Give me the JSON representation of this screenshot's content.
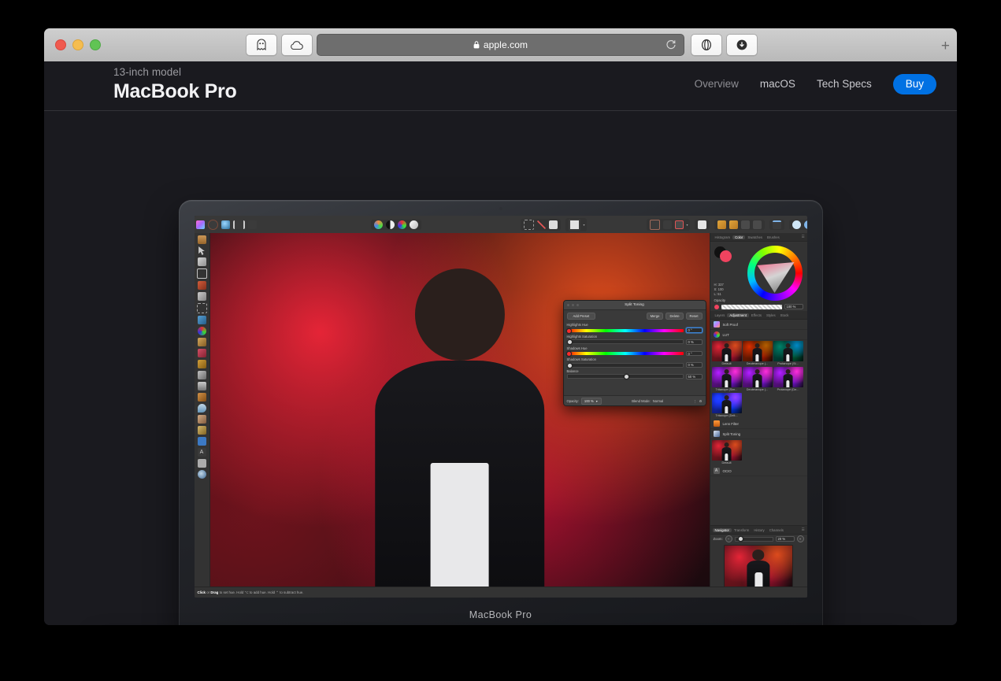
{
  "browser": {
    "url": "apple.com",
    "lock_icon": "lock-icon",
    "reload_icon": "reload-icon",
    "ghost_icon": "ghost-extension-icon",
    "cloud_icon": "cloud-extension-icon",
    "reader_icon": "reader-view-icon",
    "download_icon": "downloads-icon",
    "new_tab_label": "+",
    "traffic": [
      "close",
      "minimize",
      "zoom"
    ]
  },
  "page": {
    "kicker": "13-inch model",
    "title": "MacBook Pro",
    "nav": [
      {
        "label": "Overview",
        "active": false
      },
      {
        "label": "macOS",
        "active": true
      },
      {
        "label": "Tech Specs",
        "active": true
      }
    ],
    "cta": {
      "label": "Buy",
      "color": "#0071e3"
    }
  },
  "device": {
    "label": "MacBook Pro"
  },
  "app": {
    "status_bar": {
      "bold1": "Click",
      "mid1": " or ",
      "bold2": "Drag",
      "rest": " to set hue. Hold ⌥ to add hue. Hold ⌃ to subtract hue."
    },
    "dialog": {
      "title": "Split Toning",
      "add_preset": "Add Preset",
      "merge": "Merge",
      "delete": "Delete",
      "reset": "Reset",
      "sliders": [
        {
          "label": "Highlights Hue",
          "value": "0 °",
          "type": "hue",
          "pos": 0,
          "focused": true
        },
        {
          "label": "Highlights Saturation",
          "value": "0 %",
          "type": "plain",
          "pos": 0,
          "focused": false
        },
        {
          "label": "Shadows Hue",
          "value": "0 °",
          "type": "hue",
          "pos": 0,
          "focused": false
        },
        {
          "label": "Shadows Saturation",
          "value": "0 %",
          "type": "plain",
          "pos": 0,
          "focused": false
        },
        {
          "label": "Balance",
          "value": "50 %",
          "type": "plain",
          "pos": 50,
          "focused": false
        }
      ],
      "opacity_label": "Opacity:",
      "opacity_value": "100 %",
      "blend_label": "Blend Mode:",
      "blend_value": "Normal"
    },
    "color_panel": {
      "tabs": [
        "Histogram",
        "Color",
        "Swatches",
        "Brushes"
      ],
      "active_tab": "Color",
      "hsl": [
        "H: 337",
        "S: 100",
        "L: 51"
      ],
      "opacity_label": "Opacity",
      "opacity_value": "100 %"
    },
    "adjustment_panel": {
      "tabs": [
        "Layers",
        "Adjustment",
        "Effects",
        "Styles",
        "Stock"
      ],
      "active_tab": "Adjustment",
      "rows": [
        {
          "label": "Soft Proof",
          "icon": "soft-proof-icon"
        },
        {
          "label": "LUT",
          "icon": "lut-icon"
        }
      ],
      "lut_thumbs": [
        "Default",
        "Deuteranope (...",
        "Protanope (Si...",
        "Tritanope (Sim...",
        "Deuteranope (...",
        "Protanope (De...",
        "Tritanope (Delt..."
      ],
      "rows2": [
        {
          "label": "Lens Filter",
          "icon": "lens-filter-icon"
        },
        {
          "label": "Split Toning",
          "icon": "split-toning-icon"
        }
      ],
      "split_thumbs": [
        "Default"
      ],
      "rows3": [
        {
          "label": "OCIO",
          "icon": "ocio-icon"
        }
      ]
    },
    "navigator_panel": {
      "tabs": [
        "Navigator",
        "Transform",
        "History",
        "Channels"
      ],
      "active_tab": "Navigator",
      "zoom_label": "Zoom:",
      "zoom_value": "20 %"
    }
  }
}
